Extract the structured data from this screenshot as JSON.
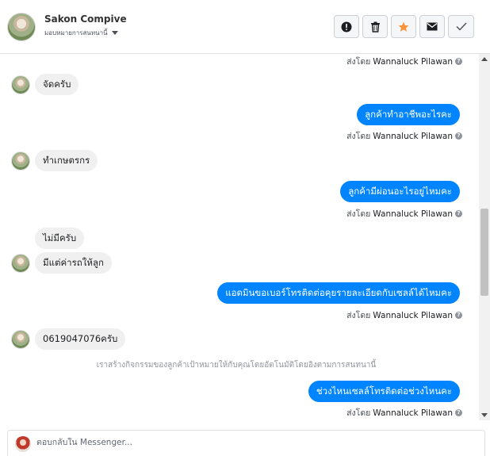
{
  "header": {
    "contact_name": "Sakon Compive",
    "assign_label": "มอบหมายการสนทนานี้",
    "actions": [
      {
        "icon": "alert-icon",
        "name": "mark-spam-button"
      },
      {
        "icon": "trash-icon",
        "name": "delete-button"
      },
      {
        "icon": "star-icon",
        "name": "star-button",
        "color": "#f7923a"
      },
      {
        "icon": "envelope-icon",
        "name": "mark-unread-button"
      },
      {
        "icon": "check-icon",
        "name": "mark-done-button"
      }
    ]
  },
  "sent_by_prefix": "ส่งโดย",
  "agent_name": "Wannaluck Pilawan",
  "info_glyph": "?",
  "messages": [
    {
      "type": "sentby"
    },
    {
      "type": "in",
      "text": "จัดครับ",
      "avatar": true
    },
    {
      "type": "out",
      "text": "ลูกค้าทำอาชีพอะไรคะ"
    },
    {
      "type": "sentby"
    },
    {
      "type": "in",
      "text": "ทำเกษตรกร",
      "avatar": true
    },
    {
      "type": "out",
      "text": "ลูกค้ามีผ่อนอะไรอยู่ไหมคะ"
    },
    {
      "type": "sentby"
    },
    {
      "type": "in",
      "text": "ไม่มีครับ",
      "avatar": false
    },
    {
      "type": "in",
      "text": "มีแต่ค่ารถให้ลูก",
      "avatar": true
    },
    {
      "type": "out",
      "text": "แอดมินขอเบอร์โทรติดต่อคุยรายละเอียดกับเซลล์ได้ไหมคะ"
    },
    {
      "type": "sentby"
    },
    {
      "type": "in",
      "text": "0619047076ครับ",
      "avatar": true
    },
    {
      "type": "system",
      "text": "เราสร้างกิจกรรมของลูกค้าเป้าหมายให้กับคุณโดยอัตโนมัติโดยอิงตามการสนทนานี้"
    },
    {
      "type": "out",
      "text": "ช่วงไหนเซลล์โทรติดต่อช่วงไหนคะ"
    },
    {
      "type": "sentby"
    }
  ],
  "composer": {
    "placeholder": "ตอบกลับใน Messenger..."
  },
  "colors": {
    "outgoing_bubble": "#0084ff",
    "incoming_bubble": "#f1f0f0",
    "star": "#f7923a"
  }
}
